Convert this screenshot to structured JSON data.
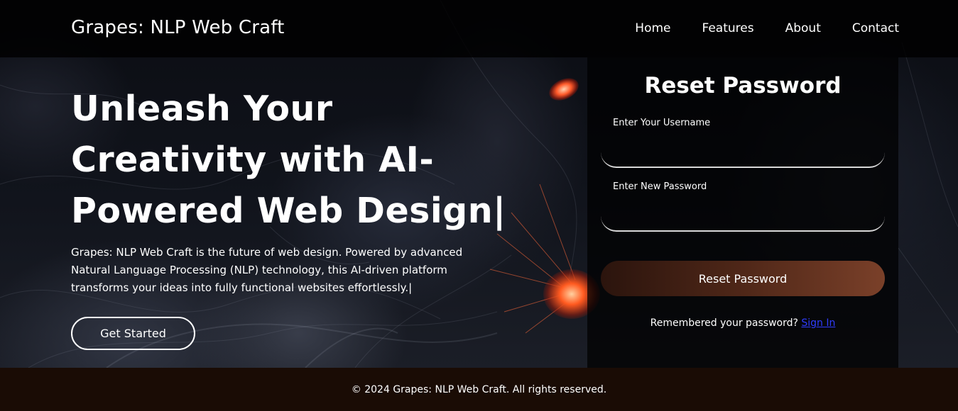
{
  "nav": {
    "brand": "Grapes: NLP Web Craft",
    "links": [
      "Home",
      "Features",
      "About",
      "Contact"
    ]
  },
  "hero": {
    "title": "Unleash Your Creativity with AI-Powered Web Design|",
    "description": "Grapes: NLP Web Craft is the future of web design. Powered by advanced Natural Language Processing (NLP) technology, this AI-driven platform transforms your ideas into fully functional websites effortlessly.|",
    "cta_label": "Get Started"
  },
  "reset": {
    "title": "Reset Password",
    "username_label": "Enter Your Username",
    "username_value": "",
    "password_label": "Enter New Password",
    "password_value": "",
    "button_label": "Reset Password",
    "remember_text": "Remembered your password?",
    "signin_label": "Sign In"
  },
  "footer": {
    "text": "© 2024 Grapes: NLP Web Craft. All rights reserved."
  },
  "colors": {
    "nav_bg": "#000000",
    "footer_bg": "#1a0c05",
    "button_gradient_start": "#2b140d",
    "button_gradient_end": "#7a4029",
    "link": "#2f3cff"
  }
}
